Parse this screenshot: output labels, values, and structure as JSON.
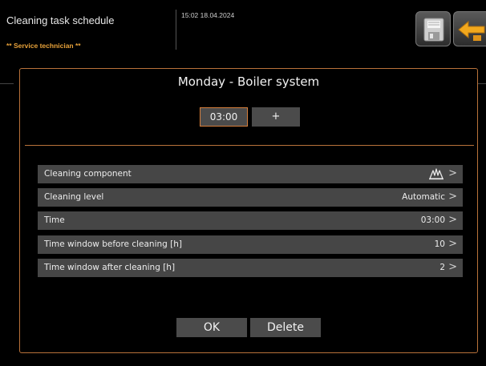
{
  "header": {
    "title": "Cleaning task schedule",
    "role": "** Service technician **",
    "datetime": "15:02 18.04.2024"
  },
  "dialog": {
    "title": "Monday - Boiler system",
    "time_value": "03:00",
    "plus_label": "+",
    "rows": [
      {
        "label": "Cleaning component",
        "value": "",
        "icon": "boiler-component-icon"
      },
      {
        "label": "Cleaning level",
        "value": "Automatic"
      },
      {
        "label": "Time",
        "value": "03:00"
      },
      {
        "label": "Time window before cleaning [h]",
        "value": "10"
      },
      {
        "label": "Time window after cleaning [h]",
        "value": "2"
      }
    ],
    "chevron": ">",
    "ok_label": "OK",
    "delete_label": "Delete"
  },
  "colors": {
    "accent": "#d77f3c",
    "role_text": "#e8a23a",
    "row_bg": "#464646",
    "back_arrow": "#f2a81d"
  },
  "icons": [
    "floppy-save-icon",
    "back-arrow-icon",
    "boiler-component-icon",
    "chevron-right-icon"
  ]
}
